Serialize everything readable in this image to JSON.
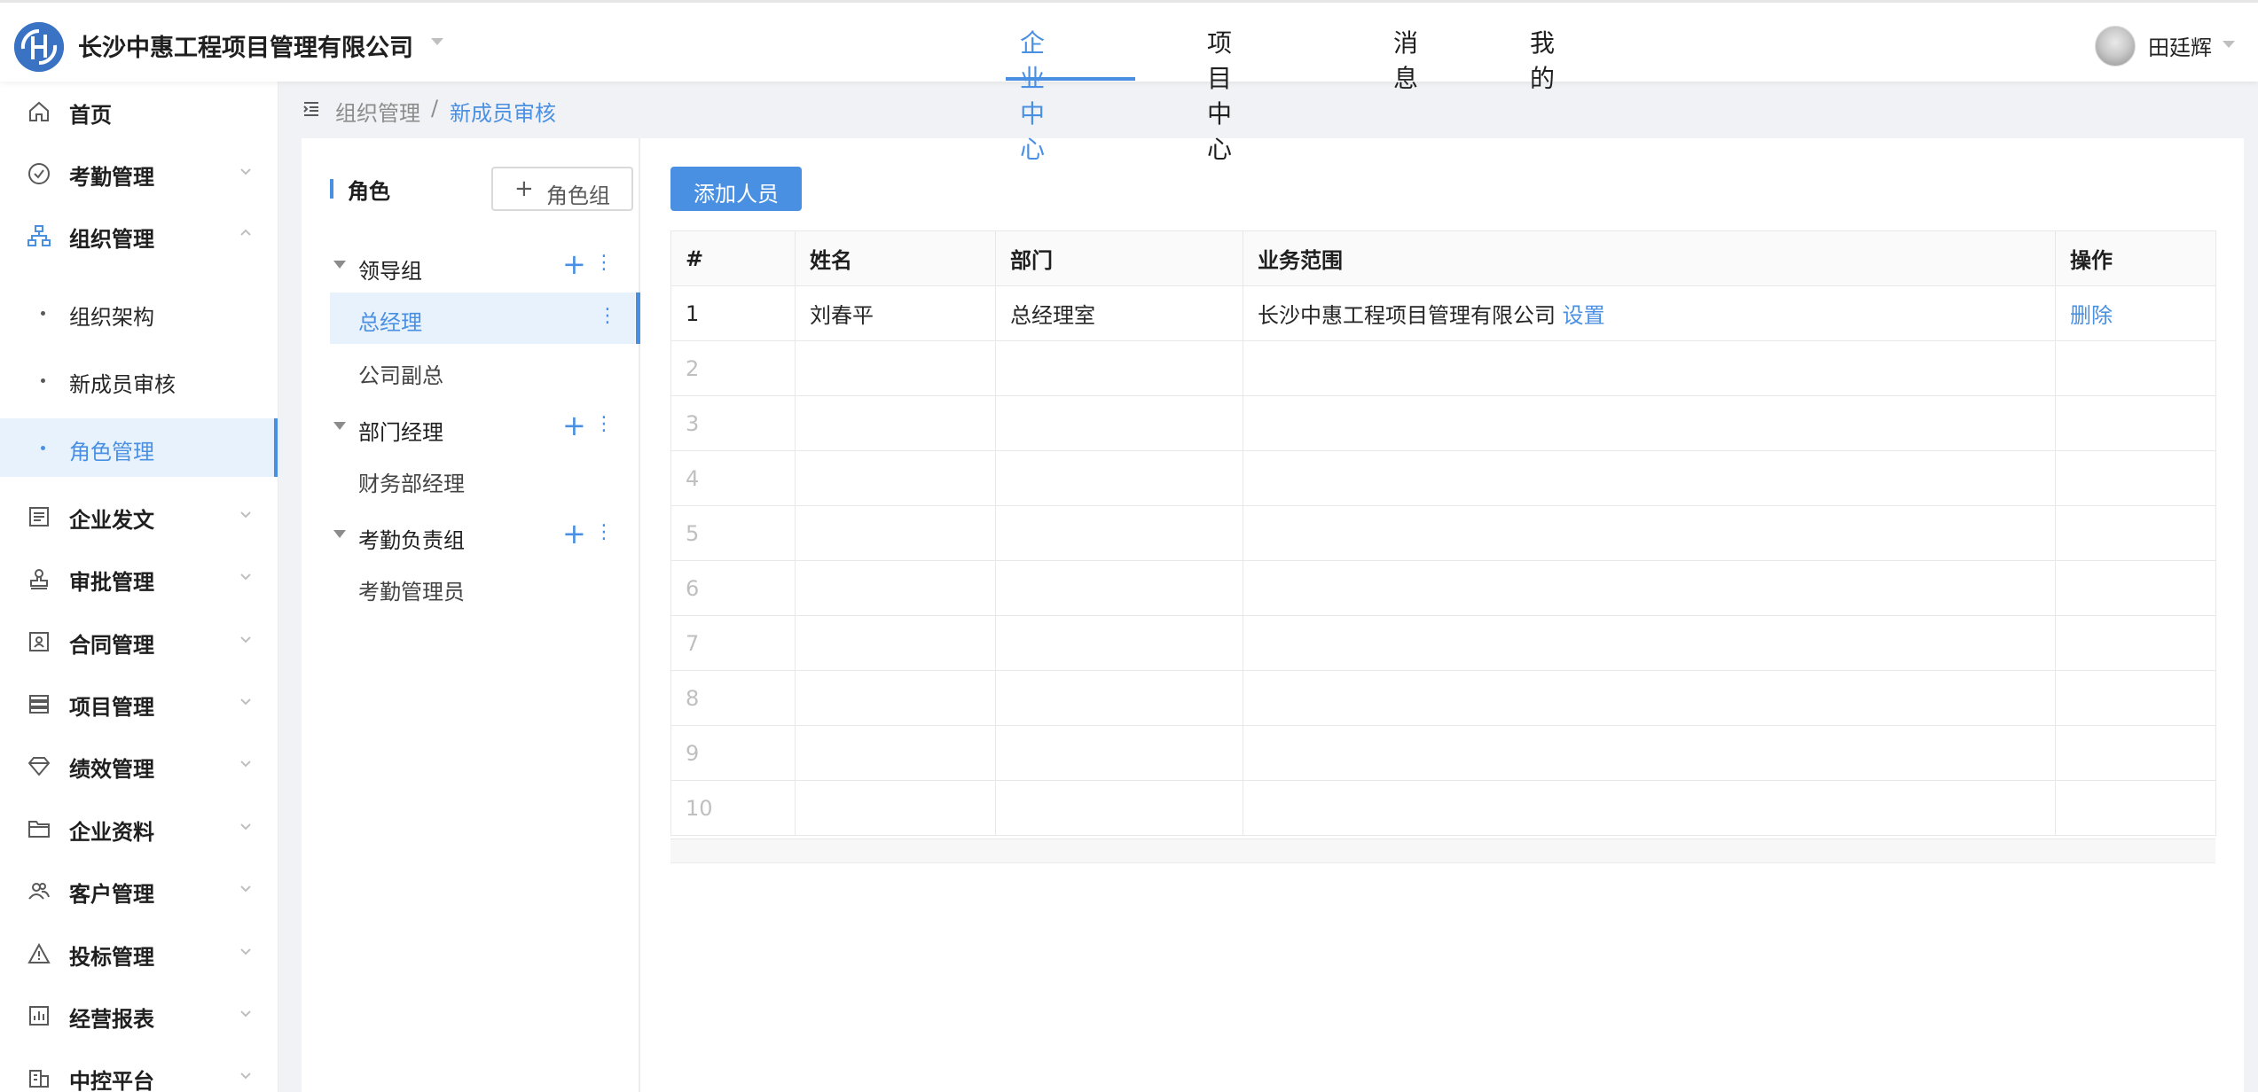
{
  "header": {
    "company": "长沙中惠工程项目管理有限公司",
    "nav": [
      {
        "label": "企业中心",
        "active": true
      },
      {
        "label": "项目中心",
        "active": false
      },
      {
        "label": "消息",
        "active": false
      },
      {
        "label": "我的",
        "active": false
      }
    ],
    "user": "田廷辉"
  },
  "sidebar": {
    "items": [
      {
        "label": "首页",
        "icon": "home-icon"
      },
      {
        "label": "考勤管理",
        "icon": "check-circle-icon"
      },
      {
        "label": "组织管理",
        "icon": "org-chart-icon",
        "expanded": true
      },
      {
        "label": "企业发文",
        "icon": "document-icon"
      },
      {
        "label": "审批管理",
        "icon": "stamp-icon"
      },
      {
        "label": "合同管理",
        "icon": "contract-icon"
      },
      {
        "label": "项目管理",
        "icon": "list-icon"
      },
      {
        "label": "绩效管理",
        "icon": "diamond-icon"
      },
      {
        "label": "企业资料",
        "icon": "folder-icon"
      },
      {
        "label": "客户管理",
        "icon": "users-icon"
      },
      {
        "label": "投标管理",
        "icon": "warning-icon"
      },
      {
        "label": "经营报表",
        "icon": "bar-chart-icon"
      },
      {
        "label": "中控平台",
        "icon": "building-icon"
      }
    ],
    "sub_items": [
      {
        "label": "组织架构"
      },
      {
        "label": "新成员审核"
      },
      {
        "label": "角色管理",
        "active": true
      }
    ]
  },
  "breadcrumb": {
    "parent": "组织管理",
    "separator": "/",
    "current": "新成员审核"
  },
  "roles": {
    "title": "角色",
    "add_group_label": "角色组",
    "groups": [
      {
        "label": "领导组",
        "roles": [
          "总经理",
          "公司副总"
        ]
      },
      {
        "label": "部门经理",
        "roles": [
          "财务部经理"
        ]
      },
      {
        "label": "考勤负责组",
        "roles": [
          "考勤管理员"
        ]
      }
    ],
    "active_role": "总经理"
  },
  "main": {
    "add_person_label": "添加人员",
    "table": {
      "headers": [
        "#",
        "姓名",
        "部门",
        "业务范围",
        "操作"
      ],
      "rows": [
        {
          "index": "1",
          "name": "刘春平",
          "department": "总经理室",
          "scope": "长沙中惠工程项目管理有限公司",
          "scope_action": "设置",
          "action": "删除"
        },
        {
          "index": "2"
        },
        {
          "index": "3"
        },
        {
          "index": "4"
        },
        {
          "index": "5"
        },
        {
          "index": "6"
        },
        {
          "index": "7"
        },
        {
          "index": "8"
        },
        {
          "index": "9"
        },
        {
          "index": "10"
        }
      ]
    }
  },
  "colors": {
    "accent": "#4a90e2",
    "active_bg": "#e8f2fd"
  }
}
